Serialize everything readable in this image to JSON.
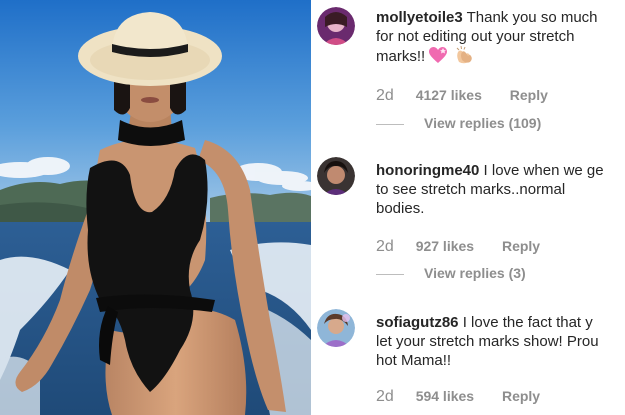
{
  "photo": {
    "alt_icon": "woman-in-swimsuit-on-boat-photo"
  },
  "comments": [
    {
      "username": "mollyetoile3",
      "lines": [
        "Thank you so much",
        "for not editing out your stretch",
        "marks!!"
      ],
      "emojis": [
        "pink-heart-icon",
        "clapping-hands-icon"
      ],
      "time": "2d",
      "likes": "4127 likes",
      "reply": "Reply",
      "view_replies": "View replies (109)"
    },
    {
      "username": "honoringme40",
      "lines": [
        "I love when we ge",
        "to see stretch marks..normal",
        "bodies."
      ],
      "time": "2d",
      "likes": "927 likes",
      "reply": "Reply",
      "view_replies": "View replies (3)"
    },
    {
      "username": "sofiagutz86",
      "lines": [
        "I love the fact that y",
        "let your stretch marks show! Prou",
        "hot Mama!!"
      ],
      "time": "2d",
      "likes": "594 likes",
      "reply": "Reply"
    }
  ],
  "colors": {
    "text": "#262626",
    "muted": "#8e8e8e",
    "sky": "#3f7fc4",
    "sea": "#2a5f9e",
    "swimsuit": "#111111",
    "hat": "#efe2c4"
  }
}
